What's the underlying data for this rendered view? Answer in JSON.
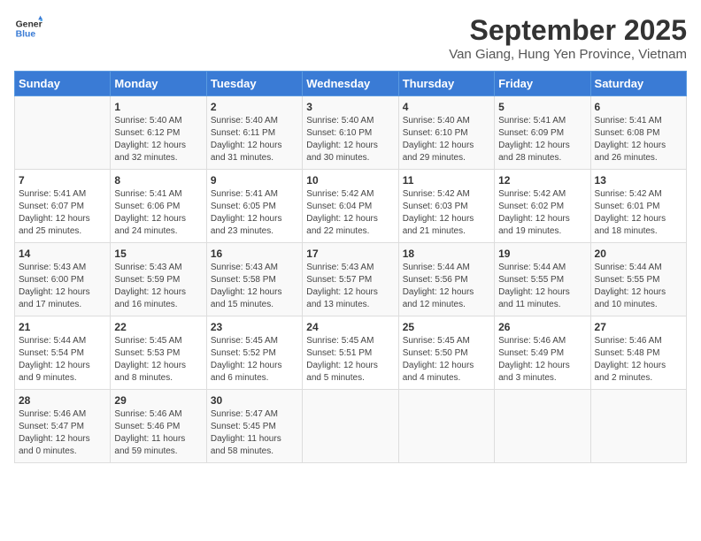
{
  "logo": {
    "general": "General",
    "blue": "Blue"
  },
  "title": "September 2025",
  "location": "Van Giang, Hung Yen Province, Vietnam",
  "days_header": [
    "Sunday",
    "Monday",
    "Tuesday",
    "Wednesday",
    "Thursday",
    "Friday",
    "Saturday"
  ],
  "weeks": [
    [
      {
        "day": "",
        "info": ""
      },
      {
        "day": "1",
        "info": "Sunrise: 5:40 AM\nSunset: 6:12 PM\nDaylight: 12 hours\nand 32 minutes."
      },
      {
        "day": "2",
        "info": "Sunrise: 5:40 AM\nSunset: 6:11 PM\nDaylight: 12 hours\nand 31 minutes."
      },
      {
        "day": "3",
        "info": "Sunrise: 5:40 AM\nSunset: 6:10 PM\nDaylight: 12 hours\nand 30 minutes."
      },
      {
        "day": "4",
        "info": "Sunrise: 5:40 AM\nSunset: 6:10 PM\nDaylight: 12 hours\nand 29 minutes."
      },
      {
        "day": "5",
        "info": "Sunrise: 5:41 AM\nSunset: 6:09 PM\nDaylight: 12 hours\nand 28 minutes."
      },
      {
        "day": "6",
        "info": "Sunrise: 5:41 AM\nSunset: 6:08 PM\nDaylight: 12 hours\nand 26 minutes."
      }
    ],
    [
      {
        "day": "7",
        "info": "Sunrise: 5:41 AM\nSunset: 6:07 PM\nDaylight: 12 hours\nand 25 minutes."
      },
      {
        "day": "8",
        "info": "Sunrise: 5:41 AM\nSunset: 6:06 PM\nDaylight: 12 hours\nand 24 minutes."
      },
      {
        "day": "9",
        "info": "Sunrise: 5:41 AM\nSunset: 6:05 PM\nDaylight: 12 hours\nand 23 minutes."
      },
      {
        "day": "10",
        "info": "Sunrise: 5:42 AM\nSunset: 6:04 PM\nDaylight: 12 hours\nand 22 minutes."
      },
      {
        "day": "11",
        "info": "Sunrise: 5:42 AM\nSunset: 6:03 PM\nDaylight: 12 hours\nand 21 minutes."
      },
      {
        "day": "12",
        "info": "Sunrise: 5:42 AM\nSunset: 6:02 PM\nDaylight: 12 hours\nand 19 minutes."
      },
      {
        "day": "13",
        "info": "Sunrise: 5:42 AM\nSunset: 6:01 PM\nDaylight: 12 hours\nand 18 minutes."
      }
    ],
    [
      {
        "day": "14",
        "info": "Sunrise: 5:43 AM\nSunset: 6:00 PM\nDaylight: 12 hours\nand 17 minutes."
      },
      {
        "day": "15",
        "info": "Sunrise: 5:43 AM\nSunset: 5:59 PM\nDaylight: 12 hours\nand 16 minutes."
      },
      {
        "day": "16",
        "info": "Sunrise: 5:43 AM\nSunset: 5:58 PM\nDaylight: 12 hours\nand 15 minutes."
      },
      {
        "day": "17",
        "info": "Sunrise: 5:43 AM\nSunset: 5:57 PM\nDaylight: 12 hours\nand 13 minutes."
      },
      {
        "day": "18",
        "info": "Sunrise: 5:44 AM\nSunset: 5:56 PM\nDaylight: 12 hours\nand 12 minutes."
      },
      {
        "day": "19",
        "info": "Sunrise: 5:44 AM\nSunset: 5:55 PM\nDaylight: 12 hours\nand 11 minutes."
      },
      {
        "day": "20",
        "info": "Sunrise: 5:44 AM\nSunset: 5:55 PM\nDaylight: 12 hours\nand 10 minutes."
      }
    ],
    [
      {
        "day": "21",
        "info": "Sunrise: 5:44 AM\nSunset: 5:54 PM\nDaylight: 12 hours\nand 9 minutes."
      },
      {
        "day": "22",
        "info": "Sunrise: 5:45 AM\nSunset: 5:53 PM\nDaylight: 12 hours\nand 8 minutes."
      },
      {
        "day": "23",
        "info": "Sunrise: 5:45 AM\nSunset: 5:52 PM\nDaylight: 12 hours\nand 6 minutes."
      },
      {
        "day": "24",
        "info": "Sunrise: 5:45 AM\nSunset: 5:51 PM\nDaylight: 12 hours\nand 5 minutes."
      },
      {
        "day": "25",
        "info": "Sunrise: 5:45 AM\nSunset: 5:50 PM\nDaylight: 12 hours\nand 4 minutes."
      },
      {
        "day": "26",
        "info": "Sunrise: 5:46 AM\nSunset: 5:49 PM\nDaylight: 12 hours\nand 3 minutes."
      },
      {
        "day": "27",
        "info": "Sunrise: 5:46 AM\nSunset: 5:48 PM\nDaylight: 12 hours\nand 2 minutes."
      }
    ],
    [
      {
        "day": "28",
        "info": "Sunrise: 5:46 AM\nSunset: 5:47 PM\nDaylight: 12 hours\nand 0 minutes."
      },
      {
        "day": "29",
        "info": "Sunrise: 5:46 AM\nSunset: 5:46 PM\nDaylight: 11 hours\nand 59 minutes."
      },
      {
        "day": "30",
        "info": "Sunrise: 5:47 AM\nSunset: 5:45 PM\nDaylight: 11 hours\nand 58 minutes."
      },
      {
        "day": "",
        "info": ""
      },
      {
        "day": "",
        "info": ""
      },
      {
        "day": "",
        "info": ""
      },
      {
        "day": "",
        "info": ""
      }
    ]
  ]
}
